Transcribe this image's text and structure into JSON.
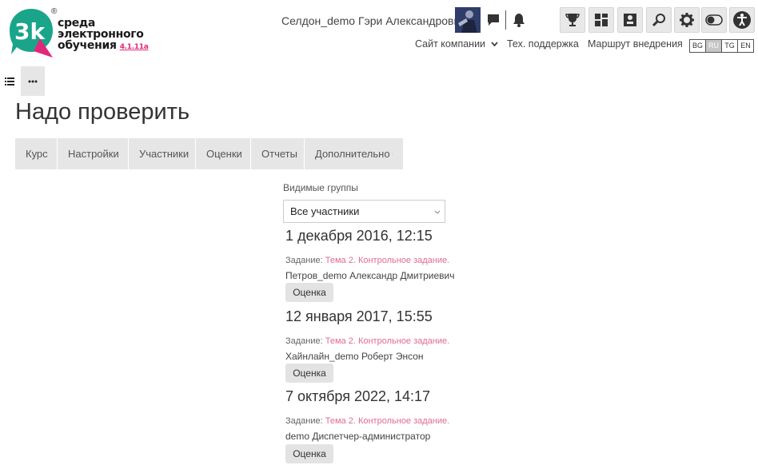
{
  "logo": {
    "lines": [
      "среда",
      "электронного",
      "обучения"
    ],
    "version": "4.1.11a",
    "reg": "®"
  },
  "header": {
    "user_name": "Селдон_demo Гэри Александрович",
    "nav": {
      "company_site": "Сайт компании",
      "support": "Тех. поддержка",
      "route": "Маршрут внедрения"
    },
    "languages": [
      "BG",
      "RU",
      "TG",
      "EN"
    ],
    "active_language": "RU"
  },
  "page": {
    "title": "Надо проверить"
  },
  "tabs": [
    "Курс",
    "Настройки",
    "Участники",
    "Оценки",
    "Отчеты",
    "Дополнительно"
  ],
  "filter": {
    "label": "Видимые группы",
    "selected": "Все участники"
  },
  "entries": [
    {
      "date": "1 декабря 2016, 12:15",
      "task_label": "Задание:",
      "task_link": "Тема 2. Контрольное задание.",
      "person": "Петров_demo Александр Дмитриевич",
      "button": "Оценка"
    },
    {
      "date": "12 января 2017, 15:55",
      "task_label": "Задание:",
      "task_link": "Тема 2. Контрольное задание.",
      "person": "Хайнлайн_demo Роберт Энсон",
      "button": "Оценка"
    },
    {
      "date": "7 октября 2022, 14:17",
      "task_label": "Задание:",
      "task_link": "Тема 2. Контрольное задание.",
      "person": "demo Диспетчер-администратор",
      "button": "Оценка"
    }
  ],
  "colors": {
    "logo_teal": "#1aa58b",
    "logo_pink": "#e0287a",
    "link_pink": "#e06b8d",
    "tab_bg": "#e6e6e6"
  },
  "icons": [
    "message-icon",
    "bell-icon",
    "trophy-icon",
    "dashboard-icon",
    "puzzle-icon",
    "search-icon",
    "gear-icon",
    "toggle-icon",
    "accessibility-icon",
    "list-icon",
    "more-icon"
  ]
}
